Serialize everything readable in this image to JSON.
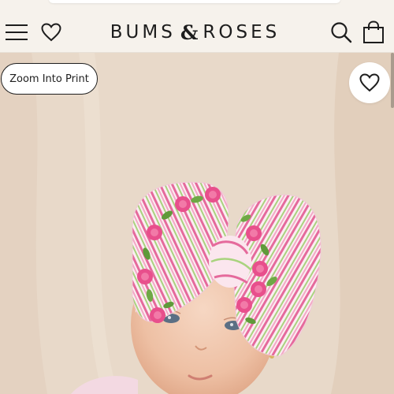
{
  "header": {
    "brand_left": "BUMS",
    "brand_amp": "&",
    "brand_right": "ROSES",
    "icons": [
      "menu-icon",
      "heart-icon",
      "search-icon",
      "bag-icon"
    ]
  },
  "product": {
    "zoom_label": "Zoom Into Print",
    "wishlist_icon": "heart-icon",
    "image_alt": "Baby wearing floral bow headband"
  },
  "colors": {
    "header_bg": "#f6f2ec",
    "text": "#1d1d1d",
    "bow_pink": "#e8649a",
    "bow_green": "#8cbf5a"
  }
}
